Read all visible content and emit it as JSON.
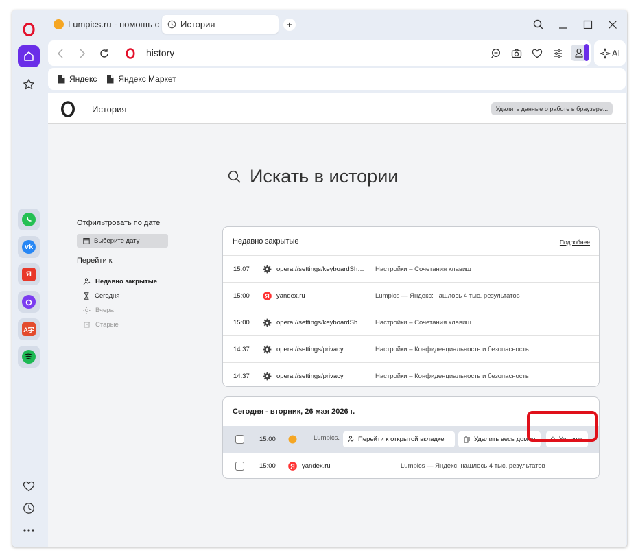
{
  "tabs": [
    {
      "label": "Lumpics.ru - помощь с ко"
    },
    {
      "label": "История"
    }
  ],
  "address": {
    "url": "history"
  },
  "ai_label": "AI",
  "bookmarks": [
    {
      "label": "Яндекс"
    },
    {
      "label": "Яндекс Маркет"
    }
  ],
  "page": {
    "title": "История",
    "clear_button": "Удалить данные о работе в браузере...",
    "search_placeholder": "Искать в истории"
  },
  "filters": {
    "date_heading": "Отфильтровать по дате",
    "date_button": "Выберите дату",
    "goto_heading": "Перейти к",
    "items": [
      {
        "label": "Недавно закрытые"
      },
      {
        "label": "Сегодня"
      },
      {
        "label": "Вчера"
      },
      {
        "label": "Старые"
      }
    ]
  },
  "recent": {
    "heading": "Недавно закрытые",
    "more_link": "Подробнее",
    "rows": [
      {
        "time": "15:07",
        "url": "opera://settings/keyboardShortcuts",
        "title": "Настройки – Сочетания клавиш",
        "icon": "gear-icon"
      },
      {
        "time": "15:00",
        "url": "yandex.ru",
        "title": "Lumpics — Яндекс: нашлось 4 тыс. результатов",
        "icon": "yandex-icon"
      },
      {
        "time": "15:00",
        "url": "opera://settings/keyboardShortcuts",
        "title": "Настройки – Сочетания клавиш",
        "icon": "gear-icon"
      },
      {
        "time": "14:37",
        "url": "opera://settings/privacy",
        "title": "Настройки – Конфиденциальность и безопасность",
        "icon": "gear-icon"
      },
      {
        "time": "14:37",
        "url": "opera://settings/privacy",
        "title": "Настройки – Конфиденциальность и безопасность",
        "icon": "gear-icon"
      }
    ]
  },
  "today": {
    "heading": "Сегодня - вторник, 26 мая 2026 г.",
    "rows": [
      {
        "time": "15:00",
        "url": "Lumpics.",
        "title": "",
        "icon": "lumpics-icon"
      },
      {
        "time": "15:00",
        "url": "yandex.ru",
        "title": "Lumpics — Яндекс: нашлось 4 тыс. результатов",
        "icon": "yandex-icon"
      }
    ],
    "actions": {
      "goto_tab": "Перейти к открытой вкладке",
      "delete_domain": "Удалить весь домен",
      "delete": "Удалить"
    }
  },
  "colors": {
    "accent": "#6a2ee8",
    "opera_red": "#e3112b",
    "highlight": "#e0101a"
  }
}
